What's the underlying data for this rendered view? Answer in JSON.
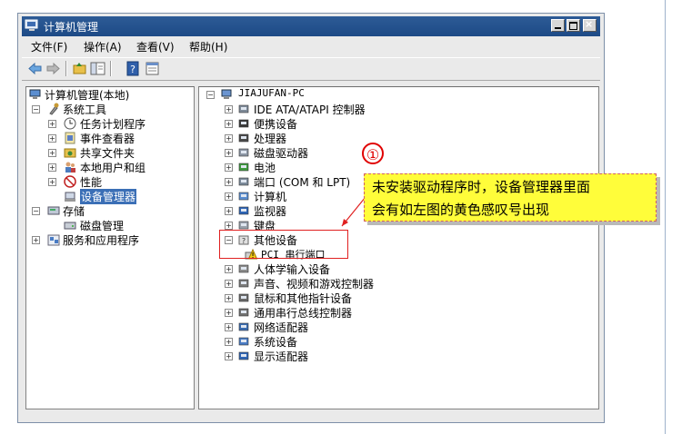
{
  "window": {
    "title": "计算机管理"
  },
  "menu": [
    {
      "label": "文件(F)"
    },
    {
      "label": "操作(A)"
    },
    {
      "label": "查看(V)"
    },
    {
      "label": "帮助(H)"
    }
  ],
  "left_tree": [
    {
      "label": "计算机管理(本地)",
      "icon": "computer-management-icon"
    },
    {
      "label": "系统工具",
      "icon": "tools-icon"
    },
    {
      "label": "任务计划程序",
      "icon": "clock-icon"
    },
    {
      "label": "事件查看器",
      "icon": "event-viewer-icon"
    },
    {
      "label": "共享文件夹",
      "icon": "shared-folder-icon"
    },
    {
      "label": "本地用户和组",
      "icon": "users-icon"
    },
    {
      "label": "性能",
      "icon": "performance-icon"
    },
    {
      "label": "设备管理器",
      "icon": "device-manager-icon"
    },
    {
      "label": "存储",
      "icon": "storage-icon"
    },
    {
      "label": "磁盘管理",
      "icon": "disk-management-icon"
    },
    {
      "label": "服务和应用程序",
      "icon": "services-icon"
    }
  ],
  "right_tree": {
    "root": "JIAJUFAN-PC",
    "categories": [
      {
        "label": "IDE ATA/ATAPI 控制器",
        "icon": "ide-controller-icon"
      },
      {
        "label": "便携设备",
        "icon": "portable-device-icon"
      },
      {
        "label": "处理器",
        "icon": "processor-icon"
      },
      {
        "label": "磁盘驱动器",
        "icon": "disk-drive-icon"
      },
      {
        "label": "电池",
        "icon": "battery-icon"
      },
      {
        "label": "端口 (COM 和 LPT)",
        "icon": "port-icon"
      },
      {
        "label": "计算机",
        "icon": "computer-icon"
      },
      {
        "label": "监视器",
        "icon": "monitor-icon"
      },
      {
        "label": "键盘",
        "icon": "keyboard-icon"
      },
      {
        "label": "其他设备",
        "icon": "other-devices-icon"
      },
      {
        "label": "PCI 串行端口",
        "icon": "warning-device-icon"
      },
      {
        "label": "人体学输入设备",
        "icon": "hid-icon"
      },
      {
        "label": "声音、视频和游戏控制器",
        "icon": "sound-icon"
      },
      {
        "label": "鼠标和其他指针设备",
        "icon": "mouse-icon"
      },
      {
        "label": "通用串行总线控制器",
        "icon": "usb-icon"
      },
      {
        "label": "网络适配器",
        "icon": "network-adapter-icon"
      },
      {
        "label": "系统设备",
        "icon": "system-device-icon"
      },
      {
        "label": "显示适配器",
        "icon": "display-adapter-icon"
      }
    ]
  },
  "annotation": {
    "number": "①",
    "line1": "未安装驱动程序时，设备管理器里面",
    "line2": "会有如左图的黄色感叹号出现"
  },
  "colors": {
    "callout_bg": "#fffd3a",
    "highlight": "#e02020",
    "titlebar": "#2d5b96",
    "selection": "#3b6fb6"
  }
}
